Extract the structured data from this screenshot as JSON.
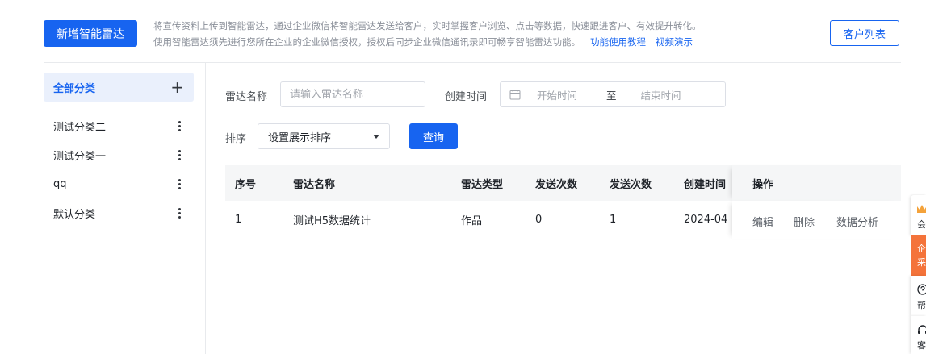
{
  "header": {
    "add_button": "新增智能雷达",
    "desc_line1": "将宣传资料上传到智能雷达，通过企业微信将智能雷达发送给客户，实时掌握客户浏览、点击等数据，快速跟进客户、有效提升转化。",
    "desc_line2": "使用智能雷达须先进行您所在企业的企业微信授权，授权后同步企业微信通讯录即可畅享智能雷达功能。",
    "link_tutorial": "功能使用教程",
    "link_video": "视频演示",
    "customer_list_button": "客户列表"
  },
  "sidebar": {
    "all_label": "全部分类",
    "items": [
      {
        "label": "测试分类二"
      },
      {
        "label": "测试分类一"
      },
      {
        "label": "qq"
      },
      {
        "label": "默认分类"
      }
    ]
  },
  "filters": {
    "name_label": "雷达名称",
    "name_placeholder": "请输入雷达名称",
    "time_label": "创建时间",
    "start_placeholder": "开始时间",
    "range_separator": "至",
    "end_placeholder": "结束时间",
    "sort_label": "排序",
    "sort_value": "设置展示排序",
    "query_button": "查询"
  },
  "table": {
    "columns": [
      "序号",
      "雷达名称",
      "雷达类型",
      "发送次数",
      "发送次数",
      "创建时间",
      "操作"
    ],
    "rows": [
      {
        "index": "1",
        "name": "测试H5数据统计",
        "type": "作品",
        "send1": "0",
        "send2": "1",
        "created": "2024-04",
        "ops": [
          "编辑",
          "删除",
          "数据分析"
        ]
      }
    ]
  },
  "float_bar": {
    "items": [
      {
        "text": "会"
      },
      {
        "text": "企",
        "text2": "采"
      },
      {
        "text": "帮"
      },
      {
        "text": "客"
      }
    ],
    "accent": "#f4733a"
  },
  "colors": {
    "primary": "#1764f0",
    "selected_bg": "#eaf0fc"
  }
}
